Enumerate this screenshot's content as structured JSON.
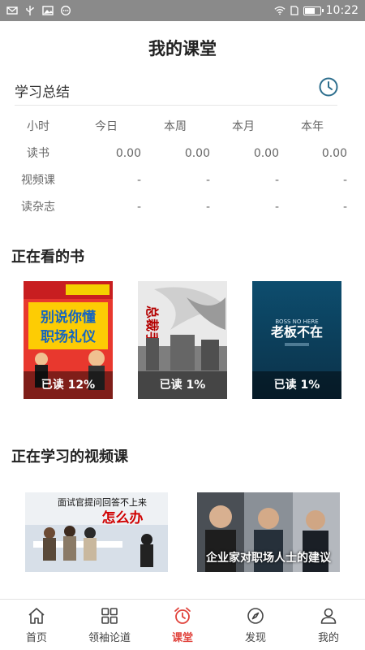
{
  "status_bar": {
    "time": "10:22"
  },
  "page_title": "我的课堂",
  "summary": {
    "label": "学习总结",
    "columns": [
      "小时",
      "今日",
      "本周",
      "本月",
      "本年"
    ],
    "rows": [
      {
        "label": "读书",
        "values": [
          "0.00",
          "0.00",
          "0.00",
          "0.00"
        ]
      },
      {
        "label": "视频课",
        "values": [
          "-",
          "-",
          "-",
          "-"
        ]
      },
      {
        "label": "读杂志",
        "values": [
          "-",
          "-",
          "-",
          "-"
        ]
      }
    ]
  },
  "reading": {
    "title": "正在看的书",
    "books": [
      {
        "cover_title": "别说你懂职场礼仪",
        "progress": "已读 12%"
      },
      {
        "cover_title": "总裁手记",
        "progress": "已读 1%"
      },
      {
        "cover_title": "老板不在",
        "cover_subtitle": "BOSS NO HERE",
        "progress": "已读 1%"
      }
    ]
  },
  "videos": {
    "title": "正在学习的视频课",
    "items": [
      {
        "top_text": "面试官提问回答不上来",
        "main_text": "怎么办"
      },
      {
        "caption": "企业家对职场人士的建议"
      }
    ]
  },
  "tabs": [
    {
      "label": "首页",
      "icon": "home-icon"
    },
    {
      "label": "领袖论道",
      "icon": "grid-icon"
    },
    {
      "label": "课堂",
      "icon": "alarm-clock-icon",
      "active": true
    },
    {
      "label": "发现",
      "icon": "compass-icon"
    },
    {
      "label": "我的",
      "icon": "person-icon"
    }
  ],
  "colors": {
    "accent": "#e0413a",
    "clock_icon": "#2e6f8e"
  }
}
